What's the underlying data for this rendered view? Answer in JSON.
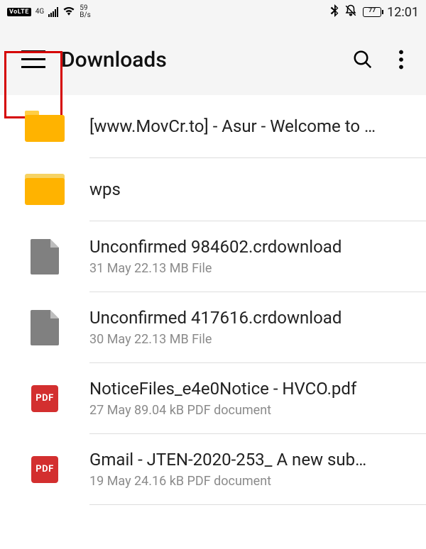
{
  "status": {
    "volte": "VoLTE",
    "net": "4G",
    "speed_num": "59",
    "speed_unit": "B/s",
    "battery": "77",
    "time": "12:01"
  },
  "header": {
    "title": "Downloads"
  },
  "items": [
    {
      "type": "folder",
      "name": "[www.MovCr.to] - Asur - Welcome to …",
      "meta": ""
    },
    {
      "type": "folder",
      "name": "wps",
      "meta": ""
    },
    {
      "type": "file",
      "name": "Unconfirmed 984602.crdownload",
      "meta": "31 May 22.13 MB File"
    },
    {
      "type": "file",
      "name": "Unconfirmed 417616.crdownload",
      "meta": "30 May 22.13 MB File"
    },
    {
      "type": "pdf",
      "name": "NoticeFiles_e4e0Notice - HVCO.pdf",
      "meta": "27 May 89.04 kB PDF document"
    },
    {
      "type": "pdf",
      "name": "Gmail - JTEN-2020-253_ A new sub…",
      "meta": "19 May 24.16 kB PDF document"
    }
  ],
  "icons": {
    "pdf_label": "PDF"
  }
}
